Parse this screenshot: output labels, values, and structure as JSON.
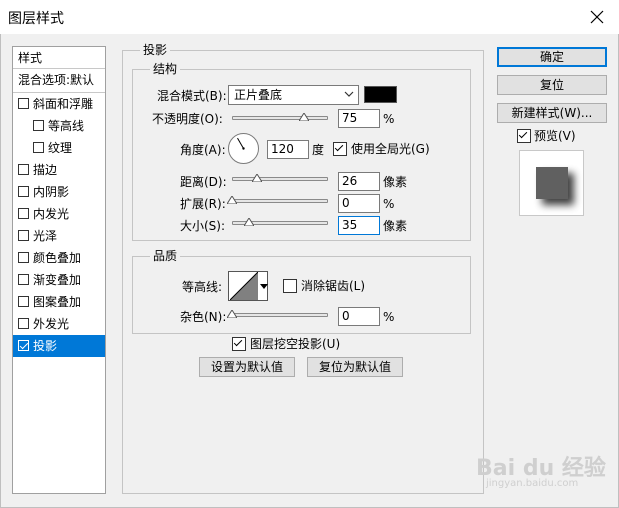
{
  "window": {
    "title": "图层样式"
  },
  "style_list": {
    "header": "样式",
    "blend_options": "混合选项:默认",
    "items": [
      {
        "label": "斜面和浮雕",
        "checked": false,
        "indent": 0
      },
      {
        "label": "等高线",
        "checked": false,
        "indent": 1
      },
      {
        "label": "纹理",
        "checked": false,
        "indent": 1
      },
      {
        "label": "描边",
        "checked": false,
        "indent": 0
      },
      {
        "label": "内阴影",
        "checked": false,
        "indent": 0
      },
      {
        "label": "内发光",
        "checked": false,
        "indent": 0
      },
      {
        "label": "光泽",
        "checked": false,
        "indent": 0
      },
      {
        "label": "颜色叠加",
        "checked": false,
        "indent": 0
      },
      {
        "label": "渐变叠加",
        "checked": false,
        "indent": 0
      },
      {
        "label": "图案叠加",
        "checked": false,
        "indent": 0
      },
      {
        "label": "外发光",
        "checked": false,
        "indent": 0
      },
      {
        "label": "投影",
        "checked": true,
        "indent": 0,
        "selected": true
      }
    ]
  },
  "drop_shadow": {
    "title": "投影",
    "structure": {
      "title": "结构",
      "blend_mode_label": "混合模式(B):",
      "blend_mode_value": "正片叠底",
      "shadow_color": "#000000",
      "opacity_label": "不透明度(O):",
      "opacity_value": "75",
      "opacity_unit": "%",
      "opacity_fraction": 0.75,
      "angle_label": "角度(A):",
      "angle_value": "120",
      "angle_unit": "度",
      "angle_degrees": 120,
      "global_light_label": "使用全局光(G)",
      "global_light_checked": true,
      "distance_label": "距离(D):",
      "distance_value": "26",
      "distance_unit": "像素",
      "distance_fraction": 0.26,
      "spread_label": "扩展(R):",
      "spread_value": "0",
      "spread_unit": "%",
      "spread_fraction": 0.0,
      "size_label": "大小(S):",
      "size_value": "35",
      "size_unit": "像素",
      "size_fraction": 0.18
    },
    "quality": {
      "title": "品质",
      "contour_label": "等高线:",
      "antialias_label": "消除锯齿(L)",
      "antialias_checked": false,
      "noise_label": "杂色(N):",
      "noise_value": "0",
      "noise_unit": "%",
      "noise_fraction": 0.0
    },
    "knockout_label": "图层挖空投影(U)",
    "knockout_checked": true,
    "set_default_label": "设置为默认值",
    "reset_default_label": "复位为默认值"
  },
  "actions": {
    "ok_label": "确定",
    "reset_label": "复位",
    "new_style_label": "新建样式(W)...",
    "preview_label": "预览(V)",
    "preview_checked": true
  },
  "watermark": {
    "brand": "Bai du 经验",
    "url": "jingyan.baidu.com"
  },
  "colors": {
    "selection": "#0078d7",
    "dialog_bg": "#f0f0f0"
  }
}
